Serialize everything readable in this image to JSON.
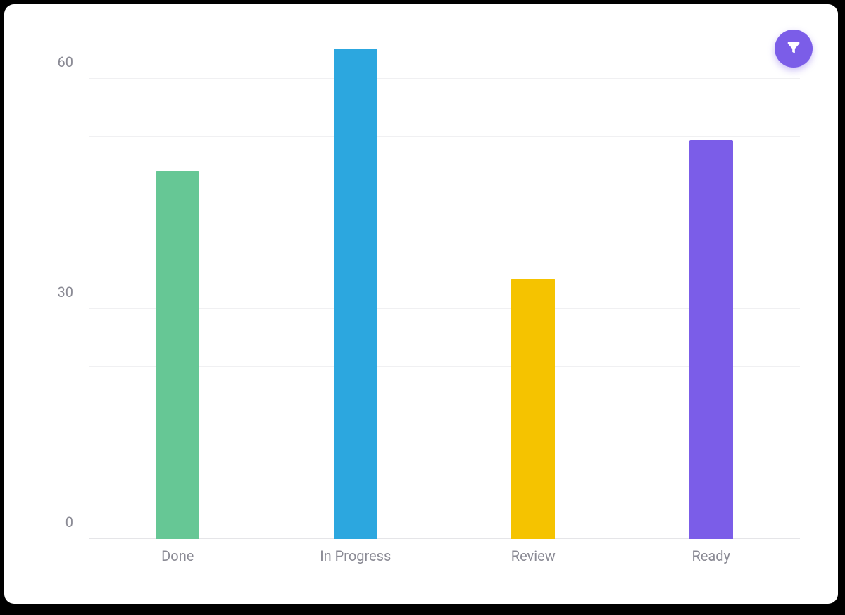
{
  "chart_data": {
    "type": "bar",
    "categories": [
      "Done",
      "In Progress",
      "Review",
      "Ready"
    ],
    "values": [
      48,
      64,
      34,
      52
    ],
    "colors": [
      "#66c795",
      "#2ca7df",
      "#f5c300",
      "#7b5de8"
    ],
    "ylim": [
      0,
      67
    ],
    "y_ticks": [
      0,
      30,
      60
    ],
    "title": "",
    "xlabel": "",
    "ylabel": ""
  },
  "filter_button": {
    "color": "#7b5de8",
    "icon": "funnel-icon"
  }
}
